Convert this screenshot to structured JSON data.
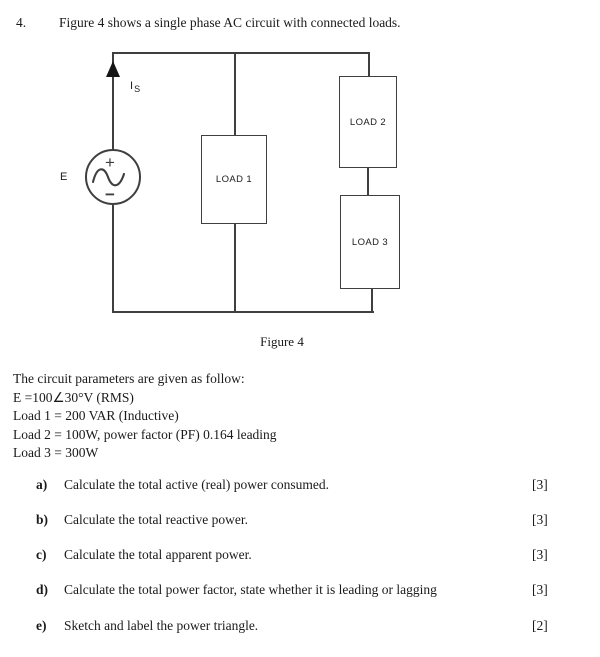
{
  "question": {
    "number": "4.",
    "prompt": "Figure 4 shows a single phase AC circuit with connected loads."
  },
  "figure": {
    "caption": "Figure 4",
    "source_label": "E",
    "current_symbol": "I",
    "current_subscript": "S",
    "source_plus": "+",
    "source_minus": "−",
    "loads": [
      {
        "name": "LOAD 1"
      },
      {
        "name": "LOAD 2"
      },
      {
        "name": "LOAD 3"
      }
    ],
    "line_color": "#3f3f3f"
  },
  "parameters": {
    "intro": "The circuit parameters are given as follow:",
    "lines": [
      "E =100∠30°V (RMS)",
      "Load 1 = 200 VAR (Inductive)",
      "Load 2 = 100W, power factor (PF) 0.164 leading",
      "Load 3 = 300W"
    ]
  },
  "subquestions": [
    {
      "tag": "a)",
      "text": "Calculate the total active (real) power consumed.",
      "marks": "[3]"
    },
    {
      "tag": "b)",
      "text": "Calculate the total reactive power.",
      "marks": "[3]"
    },
    {
      "tag": "c)",
      "text": "Calculate the total apparent power.",
      "marks": "[3]"
    },
    {
      "tag": "d)",
      "text": "Calculate the total power factor, state whether it is leading or lagging",
      "marks": "[3]"
    },
    {
      "tag": "e)",
      "text": "Sketch and label the power triangle.",
      "marks": "[2]"
    }
  ]
}
